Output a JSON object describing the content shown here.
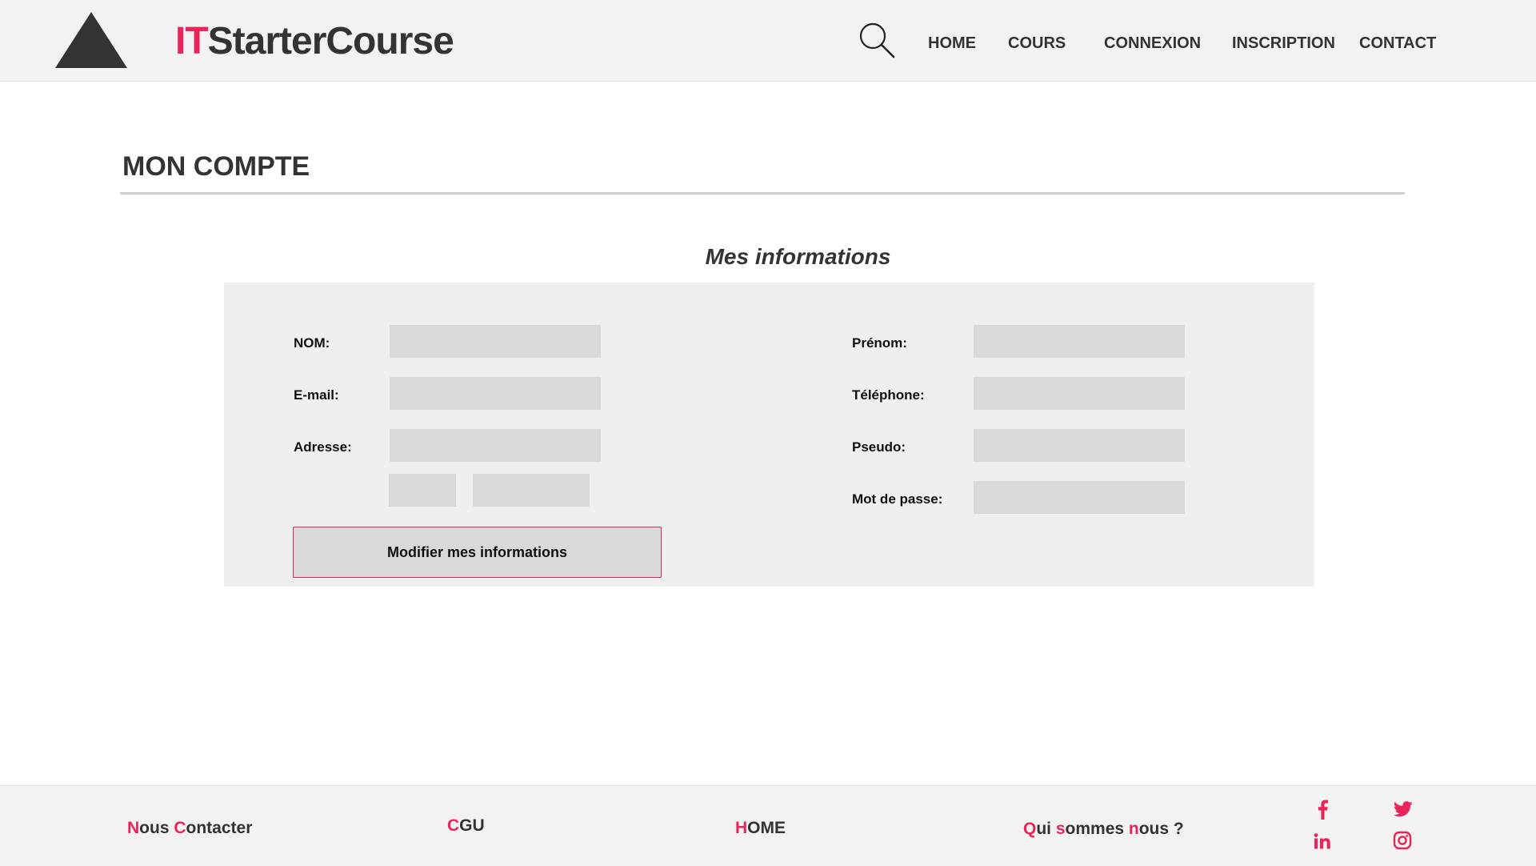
{
  "header": {
    "brand_accent": "IT",
    "brand_rest": "StarterCourse",
    "nav": [
      "HOME",
      "COURS",
      "CONNEXION",
      "INSCRIPTION",
      "CONTACT"
    ],
    "search_icon": "search-icon",
    "logo_icon": "triangle-logo"
  },
  "page": {
    "title": "MON COMPTE",
    "section_title": "Mes informations"
  },
  "form": {
    "left_labels": [
      "NOM:",
      "E-mail:",
      "Adresse:"
    ],
    "right_labels": [
      "Prénom:",
      "Téléphone:",
      "Pseudo:",
      "Mot de passe:"
    ],
    "left_values": [
      "",
      "",
      ""
    ],
    "right_values": [
      "",
      "",
      "",
      ""
    ],
    "address_extra_values": [
      "",
      ""
    ],
    "submit_label": "Modifier mes informations"
  },
  "footer": {
    "links": [
      {
        "parts": [
          [
            "N",
            "ous "
          ],
          [
            "C",
            "ontacter"
          ]
        ]
      },
      {
        "parts": [
          [
            "C",
            "GU"
          ]
        ]
      },
      {
        "parts": [
          [
            "H",
            "OME"
          ]
        ]
      },
      {
        "parts": [
          [
            "Q",
            "ui "
          ],
          [
            "s",
            "ommes "
          ],
          [
            "n",
            "ous ?"
          ]
        ]
      }
    ],
    "social_icons": [
      "facebook-icon",
      "twitter-icon",
      "linkedin-icon",
      "instagram-icon"
    ]
  },
  "colors": {
    "accent": "#e8245a",
    "dark": "#333333",
    "header_bg": "#f2f2f2",
    "panel_bg": "#efefef",
    "field_bg": "#d9d9d9"
  }
}
